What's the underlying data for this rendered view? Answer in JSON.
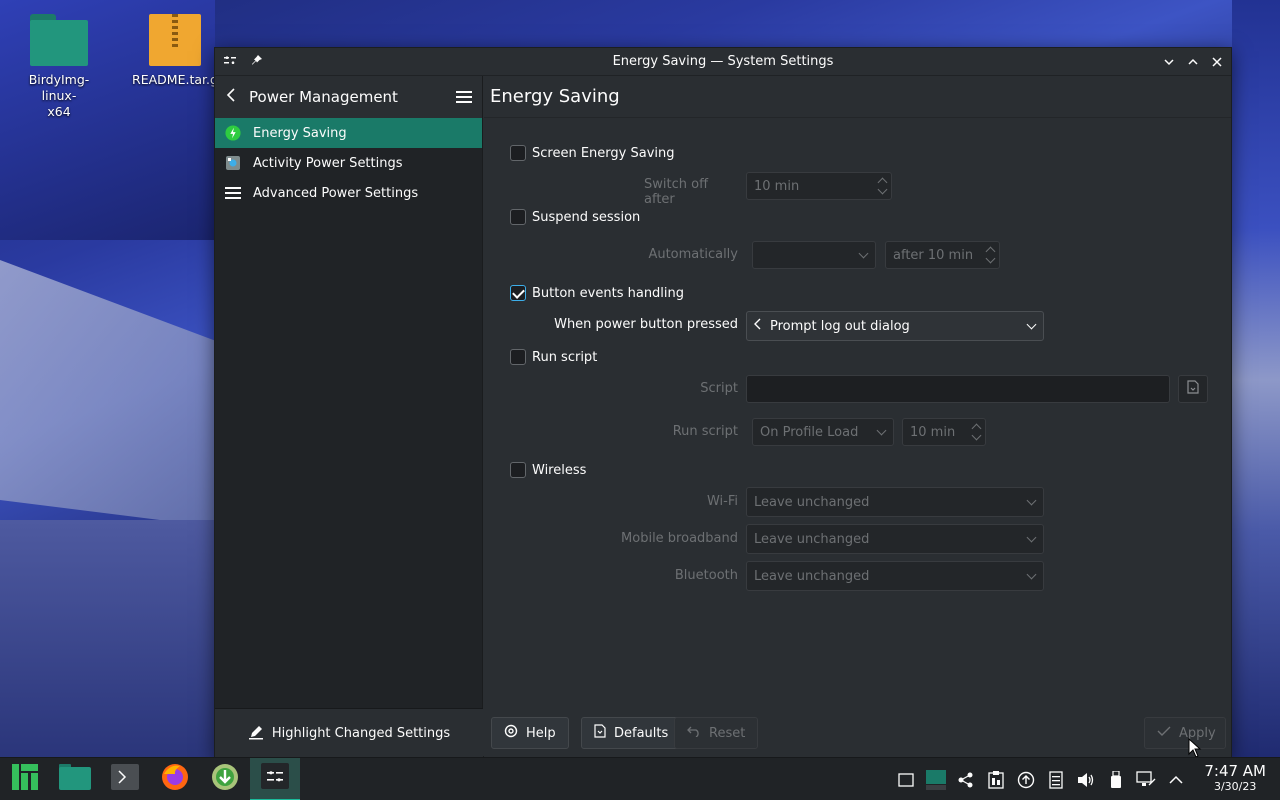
{
  "desktop": {
    "icons": [
      {
        "label_line1": "BirdyImg-linux-",
        "label_line2": "x64",
        "icon": "folder-icon"
      },
      {
        "label_line1": "README.tar.g",
        "label_line2": "",
        "icon": "archive-icon"
      }
    ]
  },
  "window": {
    "title": "Energy Saving — System Settings",
    "sidebar": {
      "header": "Power Management",
      "items": [
        {
          "label": "Energy Saving",
          "icon": "energy-icon",
          "active": true
        },
        {
          "label": "Activity Power Settings",
          "icon": "activity-icon",
          "active": false
        },
        {
          "label": "Advanced Power Settings",
          "icon": "list-icon",
          "active": false
        }
      ],
      "footer": "Highlight Changed Settings"
    },
    "main": {
      "title": "Energy Saving",
      "screen_energy_saving": {
        "label": "Screen Energy Saving",
        "checked": false,
        "switch_off_label": "Switch off after",
        "switch_off_value": "10 min"
      },
      "suspend_session": {
        "label": "Suspend session",
        "checked": false,
        "auto_label": "Automatically",
        "auto_value": "",
        "after_value": "after 10 min"
      },
      "button_events": {
        "label": "Button events handling",
        "checked": true,
        "power_label": "When power button pressed",
        "power_value": "Prompt log out dialog"
      },
      "run_script": {
        "label": "Run script",
        "checked": false,
        "script_label": "Script",
        "script_value": "",
        "run_label": "Run script",
        "run_value": "On Profile Load",
        "run_time": "10 min"
      },
      "wireless": {
        "label": "Wireless",
        "checked": false,
        "wifi_label": "Wi-Fi",
        "wifi_value": "Leave unchanged",
        "mobile_label": "Mobile broadband",
        "mobile_value": "Leave unchanged",
        "bt_label": "Bluetooth",
        "bt_value": "Leave unchanged"
      }
    },
    "buttons": {
      "help": "Help",
      "defaults": "Defaults",
      "reset": "Reset",
      "apply": "Apply"
    }
  },
  "taskbar": {
    "clock_time": "7:47 AM",
    "clock_date": "3/30/23"
  },
  "colors": {
    "accent": "#1a7a68",
    "checkbox_accent": "#3daee9",
    "panel": "#202326",
    "window": "#2a2e32"
  }
}
